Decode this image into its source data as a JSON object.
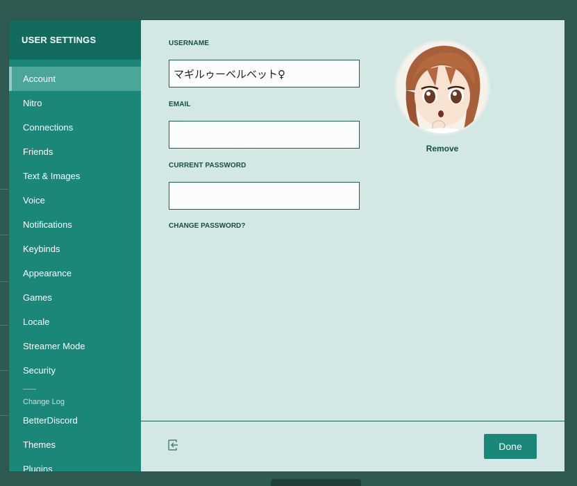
{
  "sidebar": {
    "title": "USER SETTINGS",
    "items": [
      {
        "label": "Account",
        "selected": true
      },
      {
        "label": "Nitro"
      },
      {
        "label": "Connections"
      },
      {
        "label": "Friends"
      },
      {
        "label": "Text & Images"
      },
      {
        "label": "Voice"
      },
      {
        "label": "Notifications"
      },
      {
        "label": "Keybinds"
      },
      {
        "label": "Appearance"
      },
      {
        "label": "Games"
      },
      {
        "label": "Locale"
      },
      {
        "label": "Streamer Mode"
      },
      {
        "label": "Security"
      }
    ],
    "section_label": "Change Log",
    "extra_items": [
      {
        "label": "BetterDiscord"
      },
      {
        "label": "Themes"
      },
      {
        "label": "Plugins"
      }
    ]
  },
  "account": {
    "username_label": "USERNAME",
    "username_value": "マギルゥーベルベット♀",
    "email_label": "EMAIL",
    "email_value": "",
    "password_label": "CURRENT PASSWORD",
    "password_value": "",
    "change_password_label": "CHANGE PASSWORD?",
    "avatar_remove_label": "Remove"
  },
  "footer": {
    "done_label": "Done",
    "logout_icon": "logout-icon"
  },
  "colors": {
    "background": "#2e5a52",
    "sidebar": "#1a8778",
    "sidebar_header": "#136b5f",
    "sidebar_selected": "#4ba598",
    "content": "#d3e8e4",
    "accent_text": "#134f47",
    "button": "#1a8778"
  }
}
